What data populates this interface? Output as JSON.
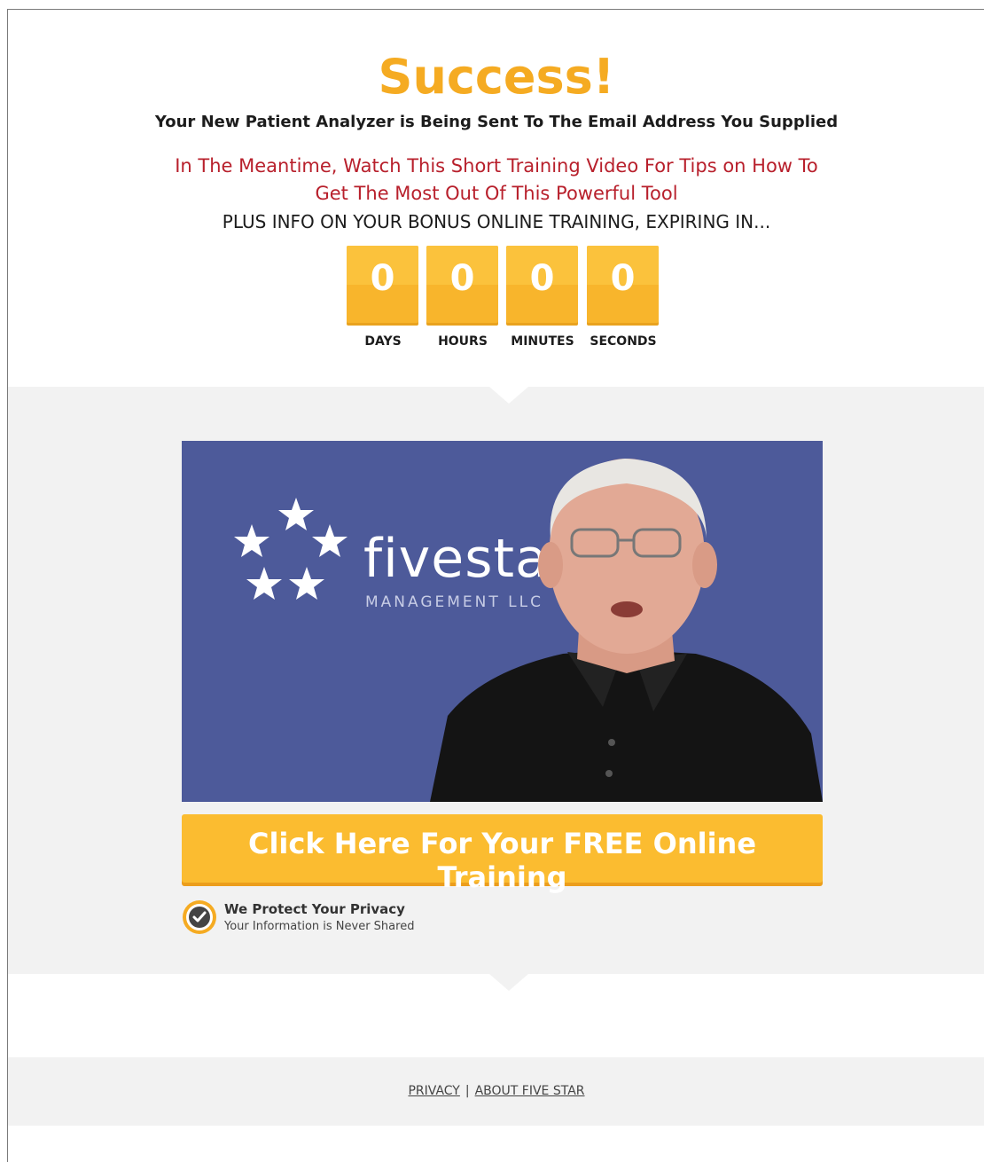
{
  "header": {
    "title": "Success!",
    "subtitle": "Your New Patient Analyzer is Being Sent To The Email Address You Supplied",
    "red_line": "In The Meantime, Watch This Short Training Video For Tips on How To Get The Most Out Of This Powerful Tool",
    "plus_line": "PLUS INFO ON YOUR BONUS ONLINE TRAINING, EXPIRING IN..."
  },
  "countdown": [
    {
      "value": "0",
      "label": "DAYS"
    },
    {
      "value": "0",
      "label": "HOURS"
    },
    {
      "value": "0",
      "label": "MINUTES"
    },
    {
      "value": "0",
      "label": "SECONDS"
    }
  ],
  "video": {
    "logo_text": "fivestar",
    "logo_sub": "MANAGEMENT LLC"
  },
  "cta": {
    "label": "Click Here For Your FREE Online Training"
  },
  "privacy": {
    "title": "We Protect Your Privacy",
    "subtitle": "Your Information is Never Shared"
  },
  "footer": {
    "links": [
      "PRIVACY",
      "ABOUT FIVE STAR"
    ],
    "separator": "|"
  },
  "colors": {
    "accent": "#f5ab22",
    "red": "#b8202c",
    "video_bg": "#4d5a9a",
    "grey_bg": "#f2f2f2"
  }
}
